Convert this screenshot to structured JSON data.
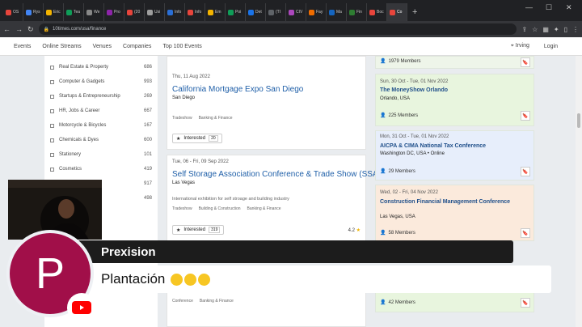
{
  "browser": {
    "tabs": [
      "OS",
      "Rys",
      "Eric",
      "Tea",
      "We",
      "Pro",
      "(20",
      "Usi",
      "Info",
      "Info",
      "Em",
      "Poi",
      "Det",
      "(TI",
      "CIV",
      "Fay",
      "Ma",
      "Fin",
      "Boc",
      "Co"
    ],
    "tab_colors": [
      "#e8453c",
      "#4285f4",
      "#f4b400",
      "#0f9d58",
      "#888888",
      "#8e24aa",
      "#e8453c",
      "#9e9e9e",
      "#2a6fd6",
      "#e8453c",
      "#f4b400",
      "#0f9d58",
      "#1a73e8",
      "#5f6368",
      "#ab47bc",
      "#ef6c00",
      "#1565c0",
      "#2e7d32",
      "#e8453c",
      "#e8453c"
    ],
    "url": "10times.com/usa/finance"
  },
  "site_nav": {
    "links": [
      "Events",
      "Online Streams",
      "Venues",
      "Companies",
      "Top 100 Events"
    ],
    "location": "Irving",
    "login": "Login"
  },
  "sidebar": {
    "categories": [
      {
        "label": "Real Estate & Property",
        "count": "686"
      },
      {
        "label": "Computer & Gadgets",
        "count": "993"
      },
      {
        "label": "Startups & Entrepreneurship",
        "count": "269"
      },
      {
        "label": "HR, Jobs & Career",
        "count": "667"
      },
      {
        "label": "Motorcycle & Bicycles",
        "count": "167"
      },
      {
        "label": "Chemicals & Dyes",
        "count": "600"
      },
      {
        "label": "Stationery",
        "count": "101"
      },
      {
        "label": "Cosmetics",
        "count": "419"
      },
      {
        "label": "",
        "count": "917"
      },
      {
        "label": "",
        "count": "498"
      }
    ]
  },
  "events": [
    {
      "date": "Thu, 11 Aug 2022",
      "title": "California Mortgage Expo San Diego",
      "city": "San Diego",
      "description": "",
      "tags": [
        "Tradeshow",
        "Banking & Finance"
      ],
      "interested_label": "Interested",
      "interested_count": "20",
      "rating": ""
    },
    {
      "date": "Tue, 06 - Fri, 09 Sep 2022",
      "title": "Self Storage Association Conference & Trade Show (SSA)",
      "city": "Las Vegas",
      "description": "International exhibition for self stroage and building industry",
      "tags": [
        "Tradeshow",
        "Building & Construction",
        "Banking & Finance"
      ],
      "interested_label": "Interested",
      "interested_count": "319",
      "rating": "4.2"
    },
    {
      "tags": [
        "Conference",
        "Banking & Finance"
      ]
    }
  ],
  "right_events": [
    {
      "date": "",
      "title": "",
      "location": "",
      "members": "1979 Members",
      "color": "#eef5e9"
    },
    {
      "date": "Sun, 30 Oct - Tue, 01 Nov 2022",
      "title": "The MoneyShow Orlando",
      "location": "Orlando, USA",
      "members": "225 Members",
      "color": "#e8f5de"
    },
    {
      "date": "Mon, 31 Oct - Tue, 01 Nov 2022",
      "title": "AICPA & CIMA National Tax Conference",
      "location": "Washington DC, USA • Online",
      "members": "29 Members",
      "color": "#e7eefb"
    },
    {
      "date": "Wed, 02 - Fri, 04 Nov 2022",
      "title": "Construction Financial Management Conference",
      "location": "Las Vegas, USA",
      "members": "58 Members",
      "color": "#fbeadc"
    },
    {
      "date": "",
      "title": "",
      "location": "",
      "members": "42 Members",
      "color": "#e8f5de"
    }
  ],
  "overlay": {
    "channel_name": "Prexision",
    "message": "Plantación",
    "avatar_letter": "P"
  }
}
